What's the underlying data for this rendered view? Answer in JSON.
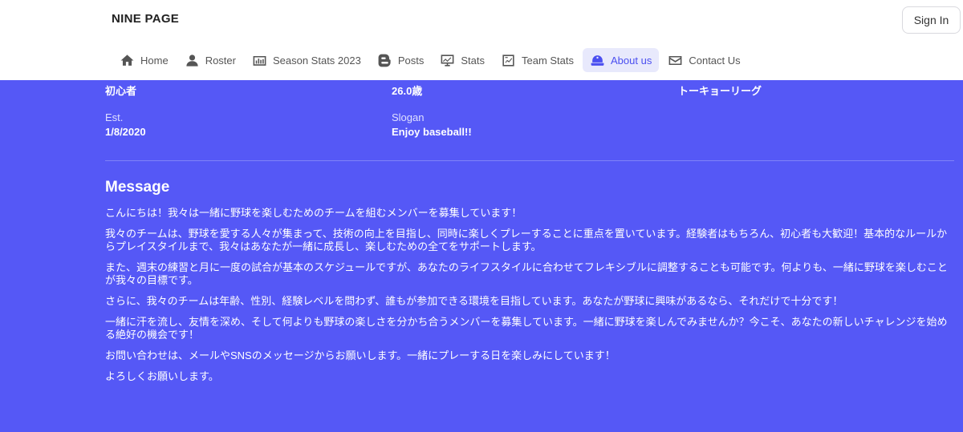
{
  "header": {
    "brand": "NINE PAGE",
    "signin_label": "Sign In"
  },
  "nav": {
    "items": [
      {
        "label": "Home",
        "icon": "home-icon"
      },
      {
        "label": "Roster",
        "icon": "user-icon"
      },
      {
        "label": "Season Stats 2023",
        "icon": "bar-chart-icon"
      },
      {
        "label": "Posts",
        "icon": "blogger-icon"
      },
      {
        "label": "Stats",
        "icon": "presentation-chart-icon"
      },
      {
        "label": "Team Stats",
        "icon": "clipboard-chart-icon"
      },
      {
        "label": "About us",
        "icon": "baseball-cap-icon",
        "active": true
      },
      {
        "label": "Contact Us",
        "icon": "mail-icon"
      }
    ],
    "active_color": "#4b4ff0",
    "active_bg": "#e8e9fc"
  },
  "team_info": {
    "level_value": "初心者",
    "age_value": "26.0歳",
    "league_value": "トーキョーリーグ",
    "est_label": "Est.",
    "est_value": "1/8/2020",
    "slogan_label": "Slogan",
    "slogan_value": "Enjoy baseball!!"
  },
  "message": {
    "title": "Message",
    "paragraphs": [
      "こんにちは！我々は一緒に野球を楽しむためのチームを組むメンバーを募集しています！",
      "我々のチームは、野球を愛する人々が集まって、技術の向上を目指し、同時に楽しくプレーすることに重点を置いています。経験者はもちろん、初心者も大歓迎！基本的なルールからプレイスタイルまで、我々はあなたが一緒に成長し、楽しむための全てをサポートします。",
      "また、週末の練習と月に一度の試合が基本のスケジュールですが、あなたのライフスタイルに合わせてフレキシブルに調整することも可能です。何よりも、一緒に野球を楽しむことが我々の目標です。",
      "さらに、我々のチームは年齢、性別、経験レベルを問わず、誰もが参加できる環境を目指しています。あなたが野球に興味があるなら、それだけで十分です！",
      "一緒に汗を流し、友情を深め、そして何よりも野球の楽しさを分かち合うメンバーを募集しています。一緒に野球を楽しんでみませんか？今こそ、あなたの新しいチャレンジを始める絶好の機会です！",
      "お問い合わせは、メールやSNSのメッセージからお願いします。一緒にプレーする日を楽しみにしています！",
      "よろしくお願いします。"
    ]
  },
  "colors": {
    "background": "#5558f6",
    "header_bg": "#ffffff"
  }
}
